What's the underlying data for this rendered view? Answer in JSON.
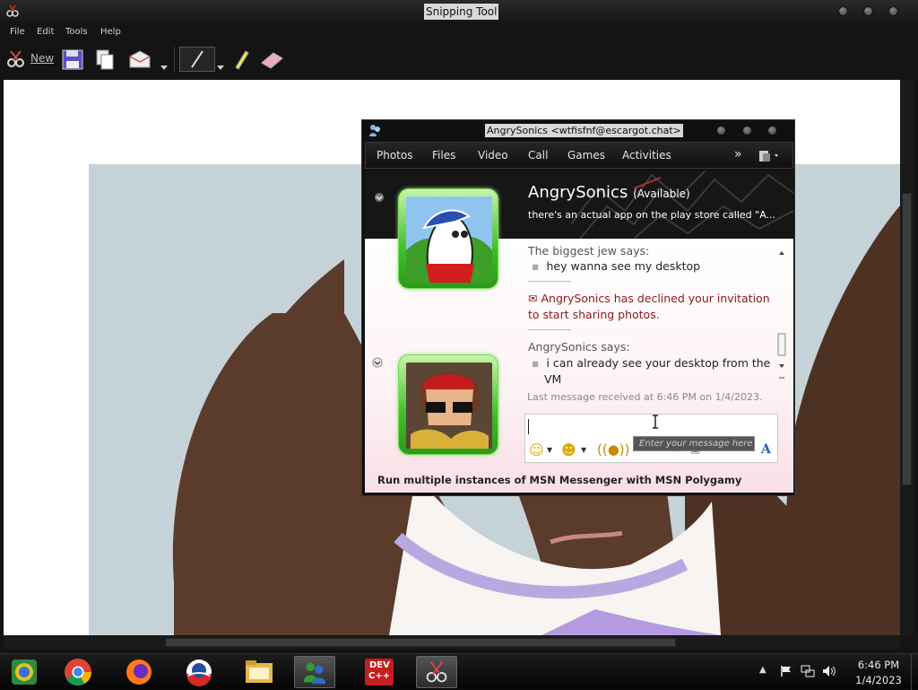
{
  "snipping_tool": {
    "title": "Snipping Tool",
    "menu": [
      "File",
      "Edit",
      "Tools",
      "Help"
    ],
    "toolbar": {
      "new_label": "New"
    }
  },
  "msn": {
    "title": "AngrySonics <wtfisfnf@escargot.chat>",
    "menu": [
      "Photos",
      "Files",
      "Video",
      "Call",
      "Games",
      "Activities"
    ],
    "more_glyph": "»",
    "contact_name": "AngrySonics",
    "contact_status": "(Available)",
    "personal_message": "there's an actual app on the play store called \"A...",
    "messages": [
      {
        "sender_line": "The biggest jew says:",
        "text": "hey wanna see my desktop"
      },
      {
        "notice": "AngrySonics has declined your invitation",
        "notice_cont": "to start sharing photos."
      },
      {
        "sender_line": "AngrySonics says:",
        "text": "i can already see your desktop from the",
        "text_cont": "VM"
      }
    ],
    "last_received": "Last message received at 6:46 PM on 1/4/2023.",
    "input_tooltip": "Enter your message here",
    "footer": "Run multiple instances of MSN Messenger with MSN Polygamy",
    "accent": "#8b1a1a"
  },
  "taskbar": {
    "time": "6:46 PM",
    "date": "1/4/2023",
    "dev_icon_text": "DEV",
    "dev_icon_text2": "C++"
  }
}
